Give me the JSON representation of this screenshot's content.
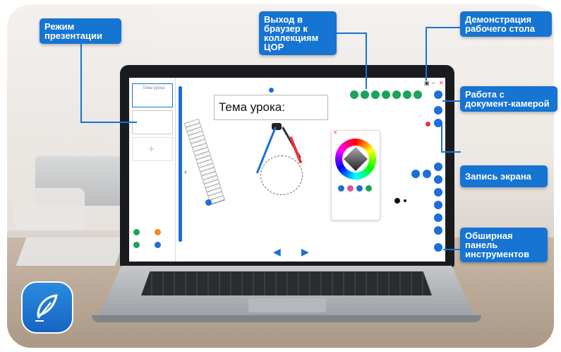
{
  "callouts": {
    "presentation_mode": "Режим презентации",
    "browser_exit": "Выход в браузер к коллекциям ЦОР",
    "desktop_demo": "Демонстрация рабочего стола",
    "document_camera": "Работа с документ-камерой",
    "screen_recording": "Запись экрана",
    "toolbar": "Обширная панель инструментов"
  },
  "screen": {
    "lesson_title": "Тема урока:",
    "thumb_caption": "Тема урока"
  },
  "colors": {
    "accent": "#1674d2",
    "green_tools": "#1aa35b",
    "record": "#ee3333"
  },
  "icons": [
    "leaf-icon",
    "record-icon",
    "close-icon",
    "minimize-icon",
    "undo-arrow-icon",
    "redo-arrow-icon",
    "color-wheel-icon",
    "compass-icon",
    "ruler-icon"
  ]
}
